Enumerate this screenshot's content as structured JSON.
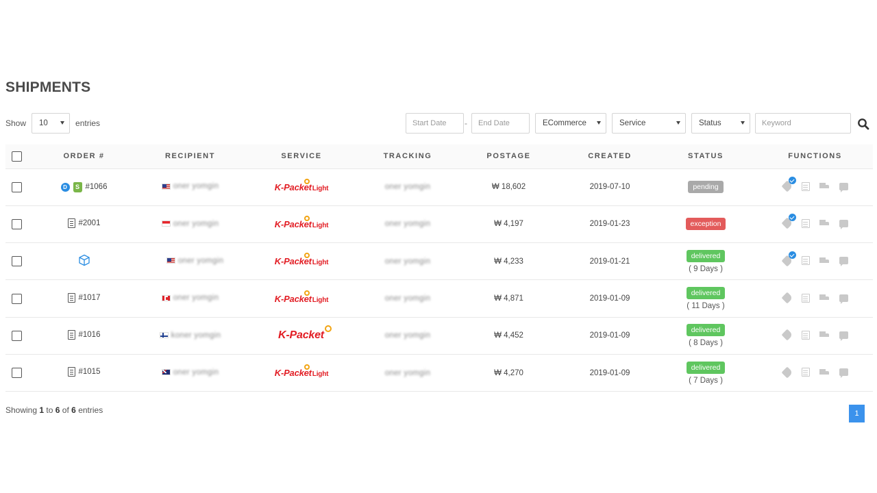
{
  "page": {
    "title": "SHIPMENTS"
  },
  "controls": {
    "show_label": "Show",
    "entries_value": "10",
    "entries_label": "entries",
    "start_date_placeholder": "Start Date",
    "date_separator": "-",
    "end_date_placeholder": "End Date",
    "ecommerce_value": "ECommerce",
    "service_value": "Service",
    "status_value": "Status",
    "keyword_placeholder": "Keyword",
    "search_icon": "search-icon"
  },
  "table": {
    "columns": [
      "ORDER #",
      "RECIPIENT",
      "SERVICE",
      "TRACKING",
      "POSTAGE",
      "CREATED",
      "STATUS",
      "FUNCTIONS"
    ],
    "rows": [
      {
        "order": "#1066",
        "recipient_flag": "US",
        "recipient": "oner yomgin",
        "service": "K-Packet",
        "service_suffix": "Light",
        "tracking": "oner yomgin",
        "postage": "₩ 18,602",
        "created": "2019-07-10",
        "status": "pending",
        "days": ""
      },
      {
        "order": "#2001",
        "recipient_flag": "SG",
        "recipient": "oner yomgin",
        "service": "K-Packet",
        "service_suffix": "Light",
        "tracking": "oner yomgin",
        "postage": "₩ 4,197",
        "created": "2019-01-23",
        "status": "exception",
        "days": ""
      },
      {
        "order": "",
        "recipient_flag": "US",
        "recipient": "oner yomgin",
        "service": "K-Packet",
        "service_suffix": "Light",
        "tracking": "oner yomgin",
        "postage": "₩ 4,233",
        "created": "2019-01-21",
        "status": "delivered",
        "days": "( 9 Days )"
      },
      {
        "order": "#1017",
        "recipient_flag": "CA",
        "recipient": "oner yomgin",
        "service": "K-Packet",
        "service_suffix": "Light",
        "tracking": "oner yomgin",
        "postage": "₩ 4,871",
        "created": "2019-01-09",
        "status": "delivered",
        "days": "( 11 Days )"
      },
      {
        "order": "#1016",
        "recipient_flag": "FI",
        "recipient": "koner yomgin",
        "service": "K-Packet",
        "service_suffix": "",
        "tracking": "oner yomgin",
        "postage": "₩ 4,452",
        "created": "2019-01-09",
        "status": "delivered",
        "days": "( 8 Days )"
      },
      {
        "order": "#1015",
        "recipient_flag": "AU",
        "recipient": "oner yomgin",
        "service": "K-Packet",
        "service_suffix": "Light",
        "tracking": "oner yomgin",
        "postage": "₩ 4,270",
        "created": "2019-01-09",
        "status": "delivered",
        "days": "( 7 Days )"
      }
    ]
  },
  "footer": {
    "showing_prefix": "Showing",
    "from": "1",
    "to_word": "to",
    "to": "6",
    "of_word": "of",
    "total": "6",
    "suffix": "entries",
    "current_page": "1"
  },
  "colors": {
    "pending": "#a9a9a9",
    "exception": "#e35b5b",
    "delivered": "#5fc65f",
    "service_red": "#e21c23",
    "pagination_blue": "#3b92ec"
  }
}
